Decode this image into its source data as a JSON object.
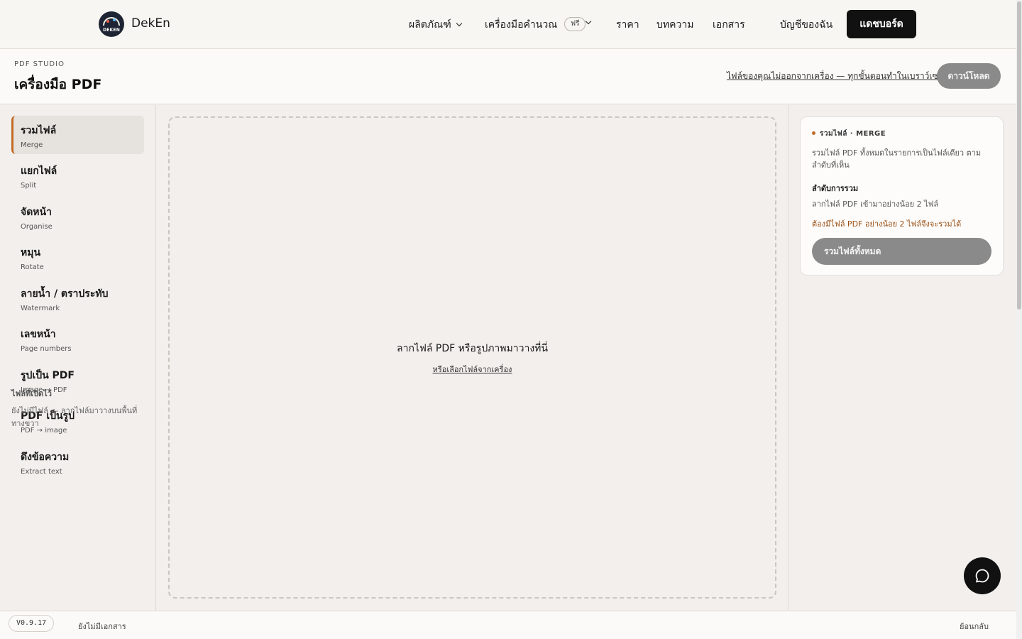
{
  "nav": {
    "brand": "DekEn",
    "logo_text": "DEKEN",
    "items": [
      {
        "label": "ผลิตภัณฑ์",
        "has_dropdown": true
      },
      {
        "label": "เครื่องมือคำนวณ",
        "has_dropdown": true,
        "badge": "ฟรี"
      },
      {
        "label": "ราคา",
        "has_dropdown": false
      },
      {
        "label": "บทความ",
        "has_dropdown": false
      },
      {
        "label": "เอกสาร",
        "has_dropdown": false
      }
    ],
    "account": "บัญชีของฉัน",
    "dashboard_button": "แดชบอร์ด"
  },
  "subheader": {
    "kicker": "PDF STUDIO",
    "title": "เครื่องมือ PDF",
    "privacy_note": "ไฟล์ของคุณไม่ออกจากเครื่อง — ทุกขั้นตอนทำในเบราว์เซอร์นี้",
    "download_button": "ดาวน์โหลด"
  },
  "sidebar": {
    "tools": [
      {
        "th": "รวมไฟล์",
        "en": "Merge",
        "active": true
      },
      {
        "th": "แยกไฟล์",
        "en": "Split",
        "active": false
      },
      {
        "th": "จัดหน้า",
        "en": "Organise",
        "active": false
      },
      {
        "th": "หมุน",
        "en": "Rotate",
        "active": false
      },
      {
        "th": "ลายน้ำ / ตราประทับ",
        "en": "Watermark",
        "active": false
      },
      {
        "th": "เลขหน้า",
        "en": "Page numbers",
        "active": false
      },
      {
        "th": "รูปเป็น PDF",
        "en": "Image → PDF",
        "active": false
      },
      {
        "th": "PDF เป็นรูป",
        "en": "PDF → image",
        "active": false
      },
      {
        "th": "ดึงข้อความ",
        "en": "Extract text",
        "active": false
      }
    ],
    "open_files_title": "ไฟล์ที่เปิดไว้",
    "open_files_empty": "ยังไม่มีไฟล์ — ลากไฟล์มาวางบนพื้นที่ทางขวา"
  },
  "dropzone": {
    "main_text": "ลากไฟล์ PDF หรือรูปภาพมาวางที่นี่",
    "browse_link": "หรือเลือกไฟล์จากเครื่อง"
  },
  "panel": {
    "heading": "รวมไฟล์ · MERGE",
    "description": "รวมไฟล์ PDF ทั้งหมดในรายการเป็นไฟล์เดียว ตามลำดับที่เห็น",
    "order_title": "ลำดับการรวม",
    "order_hint": "ลากไฟล์ PDF เข้ามาอย่างน้อย 2 ไฟล์",
    "warning": "ต้องมีไฟล์ PDF อย่างน้อย 2 ไฟล์จึงจะรวมได้",
    "merge_button": "รวมไฟล์ทั้งหมด"
  },
  "footer": {
    "version": "V0.9.17",
    "status": "ยังไม่มีเอกสาร",
    "back": "ย้อนกลับ"
  },
  "colors": {
    "accent": "#c26b25",
    "dark": "#111111",
    "disabled_button": "#8a8a8a",
    "warning_text": "#9a4f14"
  },
  "icons": {
    "chat": "chat-bubble-icon",
    "dropdown": "chevron-down-icon"
  }
}
